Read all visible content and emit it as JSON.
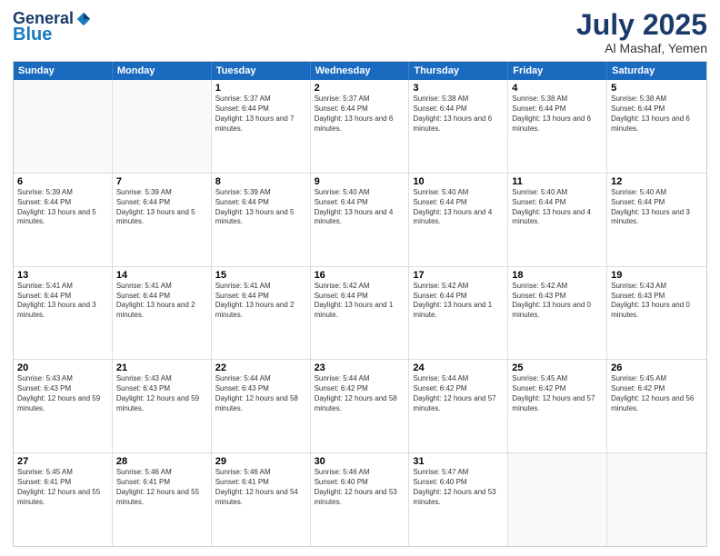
{
  "logo": {
    "general": "General",
    "blue": "Blue"
  },
  "title": {
    "month": "July 2025",
    "location": "Al Mashaf, Yemen"
  },
  "calendar": {
    "headers": [
      "Sunday",
      "Monday",
      "Tuesday",
      "Wednesday",
      "Thursday",
      "Friday",
      "Saturday"
    ],
    "weeks": [
      [
        {
          "day": "",
          "content": ""
        },
        {
          "day": "",
          "content": ""
        },
        {
          "day": "1",
          "content": "Sunrise: 5:37 AM\nSunset: 6:44 PM\nDaylight: 13 hours and 7 minutes."
        },
        {
          "day": "2",
          "content": "Sunrise: 5:37 AM\nSunset: 6:44 PM\nDaylight: 13 hours and 6 minutes."
        },
        {
          "day": "3",
          "content": "Sunrise: 5:38 AM\nSunset: 6:44 PM\nDaylight: 13 hours and 6 minutes."
        },
        {
          "day": "4",
          "content": "Sunrise: 5:38 AM\nSunset: 6:44 PM\nDaylight: 13 hours and 6 minutes."
        },
        {
          "day": "5",
          "content": "Sunrise: 5:38 AM\nSunset: 6:44 PM\nDaylight: 13 hours and 6 minutes."
        }
      ],
      [
        {
          "day": "6",
          "content": "Sunrise: 5:39 AM\nSunset: 6:44 PM\nDaylight: 13 hours and 5 minutes."
        },
        {
          "day": "7",
          "content": "Sunrise: 5:39 AM\nSunset: 6:44 PM\nDaylight: 13 hours and 5 minutes."
        },
        {
          "day": "8",
          "content": "Sunrise: 5:39 AM\nSunset: 6:44 PM\nDaylight: 13 hours and 5 minutes."
        },
        {
          "day": "9",
          "content": "Sunrise: 5:40 AM\nSunset: 6:44 PM\nDaylight: 13 hours and 4 minutes."
        },
        {
          "day": "10",
          "content": "Sunrise: 5:40 AM\nSunset: 6:44 PM\nDaylight: 13 hours and 4 minutes."
        },
        {
          "day": "11",
          "content": "Sunrise: 5:40 AM\nSunset: 6:44 PM\nDaylight: 13 hours and 4 minutes."
        },
        {
          "day": "12",
          "content": "Sunrise: 5:40 AM\nSunset: 6:44 PM\nDaylight: 13 hours and 3 minutes."
        }
      ],
      [
        {
          "day": "13",
          "content": "Sunrise: 5:41 AM\nSunset: 6:44 PM\nDaylight: 13 hours and 3 minutes."
        },
        {
          "day": "14",
          "content": "Sunrise: 5:41 AM\nSunset: 6:44 PM\nDaylight: 13 hours and 2 minutes."
        },
        {
          "day": "15",
          "content": "Sunrise: 5:41 AM\nSunset: 6:44 PM\nDaylight: 13 hours and 2 minutes."
        },
        {
          "day": "16",
          "content": "Sunrise: 5:42 AM\nSunset: 6:44 PM\nDaylight: 13 hours and 1 minute."
        },
        {
          "day": "17",
          "content": "Sunrise: 5:42 AM\nSunset: 6:44 PM\nDaylight: 13 hours and 1 minute."
        },
        {
          "day": "18",
          "content": "Sunrise: 5:42 AM\nSunset: 6:43 PM\nDaylight: 13 hours and 0 minutes."
        },
        {
          "day": "19",
          "content": "Sunrise: 5:43 AM\nSunset: 6:43 PM\nDaylight: 13 hours and 0 minutes."
        }
      ],
      [
        {
          "day": "20",
          "content": "Sunrise: 5:43 AM\nSunset: 6:43 PM\nDaylight: 12 hours and 59 minutes."
        },
        {
          "day": "21",
          "content": "Sunrise: 5:43 AM\nSunset: 6:43 PM\nDaylight: 12 hours and 59 minutes."
        },
        {
          "day": "22",
          "content": "Sunrise: 5:44 AM\nSunset: 6:43 PM\nDaylight: 12 hours and 58 minutes."
        },
        {
          "day": "23",
          "content": "Sunrise: 5:44 AM\nSunset: 6:42 PM\nDaylight: 12 hours and 58 minutes."
        },
        {
          "day": "24",
          "content": "Sunrise: 5:44 AM\nSunset: 6:42 PM\nDaylight: 12 hours and 57 minutes."
        },
        {
          "day": "25",
          "content": "Sunrise: 5:45 AM\nSunset: 6:42 PM\nDaylight: 12 hours and 57 minutes."
        },
        {
          "day": "26",
          "content": "Sunrise: 5:45 AM\nSunset: 6:42 PM\nDaylight: 12 hours and 56 minutes."
        }
      ],
      [
        {
          "day": "27",
          "content": "Sunrise: 5:45 AM\nSunset: 6:41 PM\nDaylight: 12 hours and 55 minutes."
        },
        {
          "day": "28",
          "content": "Sunrise: 5:46 AM\nSunset: 6:41 PM\nDaylight: 12 hours and 55 minutes."
        },
        {
          "day": "29",
          "content": "Sunrise: 5:46 AM\nSunset: 6:41 PM\nDaylight: 12 hours and 54 minutes."
        },
        {
          "day": "30",
          "content": "Sunrise: 5:46 AM\nSunset: 6:40 PM\nDaylight: 12 hours and 53 minutes."
        },
        {
          "day": "31",
          "content": "Sunrise: 5:47 AM\nSunset: 6:40 PM\nDaylight: 12 hours and 53 minutes."
        },
        {
          "day": "",
          "content": ""
        },
        {
          "day": "",
          "content": ""
        }
      ]
    ]
  }
}
